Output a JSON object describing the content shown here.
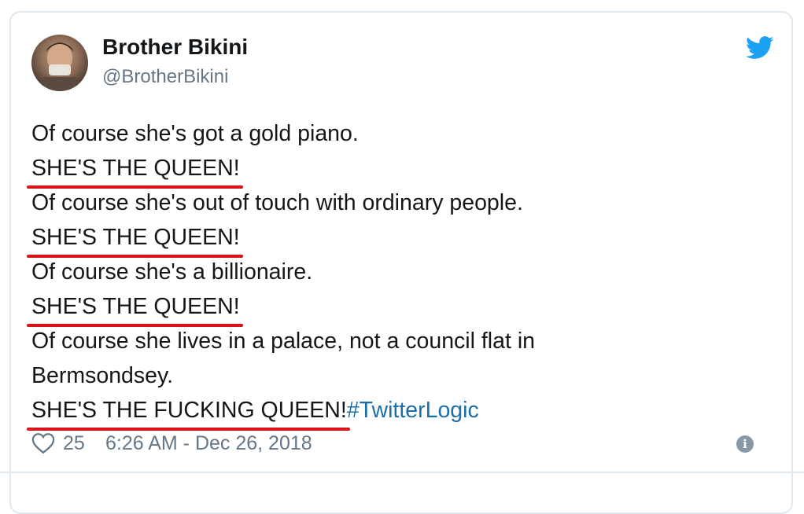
{
  "tweet": {
    "author": {
      "display_name": "Brother Bikini",
      "handle": "@BrotherBikini",
      "avatar_icon": "user-avatar"
    },
    "brand_icon": "twitter-bird-icon",
    "lines": [
      {
        "text": "Of course she's got a gold piano.",
        "underlined": false
      },
      {
        "text": "SHE'S THE QUEEN!",
        "underlined": true
      },
      {
        "text": "Of course she's out of touch with ordinary people.",
        "underlined": false
      },
      {
        "text": "SHE'S THE QUEEN!",
        "underlined": true
      },
      {
        "text": "Of course she's a billionaire.",
        "underlined": false
      },
      {
        "text": "SHE'S THE QUEEN!",
        "underlined": true
      },
      {
        "text": "Of course she lives in a palace, not a council flat in",
        "underlined": false
      },
      {
        "text": "Bermsondsey.",
        "underlined": false
      },
      {
        "text": "SHE'S THE FUCKING QUEEN!",
        "underlined": true
      }
    ],
    "hashtag": "#TwitterLogic",
    "likes": "25",
    "timestamp": "6:26 AM - Dec 26, 2018",
    "info_glyph": "i",
    "colors": {
      "underline": "#d7141a",
      "hashtag": "#1b6fa8",
      "twitter_blue": "#1da1f2",
      "muted": "#657786"
    }
  }
}
